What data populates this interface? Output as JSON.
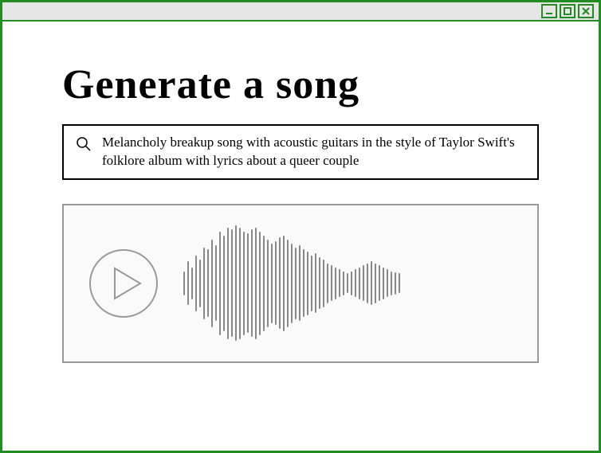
{
  "window": {
    "controls": {
      "minimize": "minimize",
      "maximize": "maximize",
      "close": "close"
    }
  },
  "page": {
    "title": "Generate a song"
  },
  "search": {
    "icon": "search-icon",
    "value": "Melancholy breakup song with acoustic guitars in the style of Taylor Swift's folklore album with lyrics about a queer couple"
  },
  "player": {
    "play_icon": "play-icon",
    "waveform_bars": [
      30,
      55,
      40,
      70,
      60,
      90,
      85,
      110,
      95,
      130,
      120,
      140,
      135,
      145,
      140,
      130,
      125,
      135,
      140,
      130,
      120,
      110,
      100,
      105,
      115,
      120,
      110,
      100,
      90,
      95,
      85,
      80,
      70,
      75,
      65,
      60,
      50,
      45,
      40,
      35,
      30,
      25,
      30,
      35,
      40,
      45,
      50,
      55,
      50,
      45,
      40,
      35,
      30,
      28,
      25
    ]
  }
}
